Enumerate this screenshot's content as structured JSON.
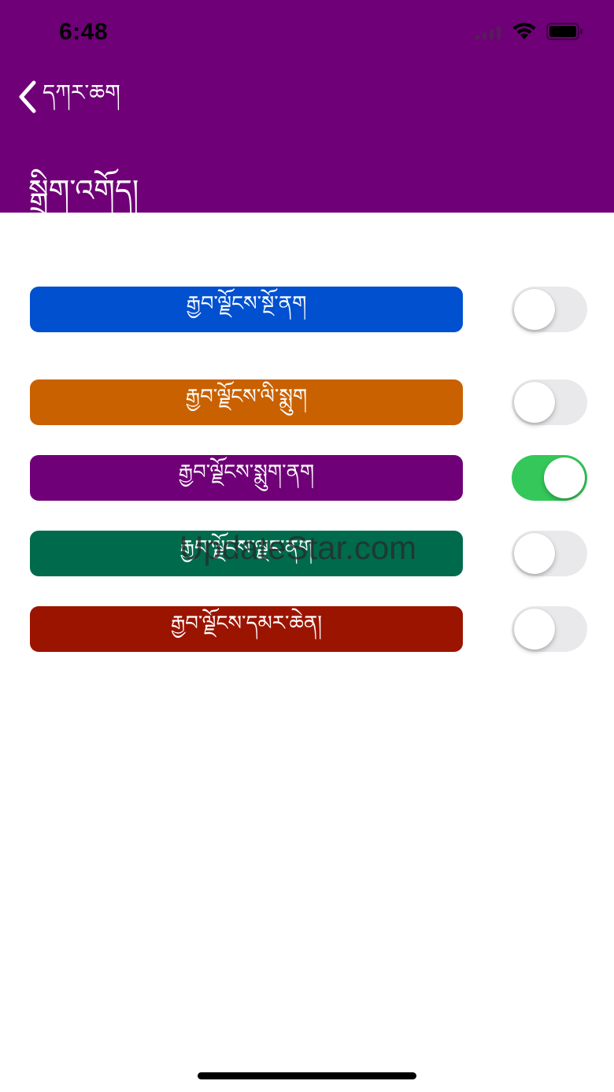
{
  "status_bar": {
    "time": "6:48"
  },
  "nav": {
    "back_label": "དཀར་ཆག",
    "title": "སྒྲིག་འགོད།"
  },
  "colors": {
    "header": "#6f0077",
    "toggle_on": "#34c759",
    "toggle_off": "#e9e9eb"
  },
  "themes": [
    {
      "label": "རྒྱབ་ལྗོངས་སྔོ་ནག",
      "color": "#0050d0",
      "enabled": false
    },
    {
      "label": "རྒྱབ་ལྗོངས་ལི་སྨུག",
      "color": "#c96100",
      "enabled": false
    },
    {
      "label": "རྒྱབ་ལྗོངས་སྨུག་ནག",
      "color": "#6f0077",
      "enabled": true
    },
    {
      "label": "རྒྱབ་ལྗོངས་ལྗང་ནག",
      "color": "#006b4c",
      "enabled": false
    },
    {
      "label": "རྒྱབ་ལྗོངས་དམར་ཆེན།",
      "color": "#9b1400",
      "enabled": false
    }
  ],
  "watermark": "UpdateStar.com"
}
